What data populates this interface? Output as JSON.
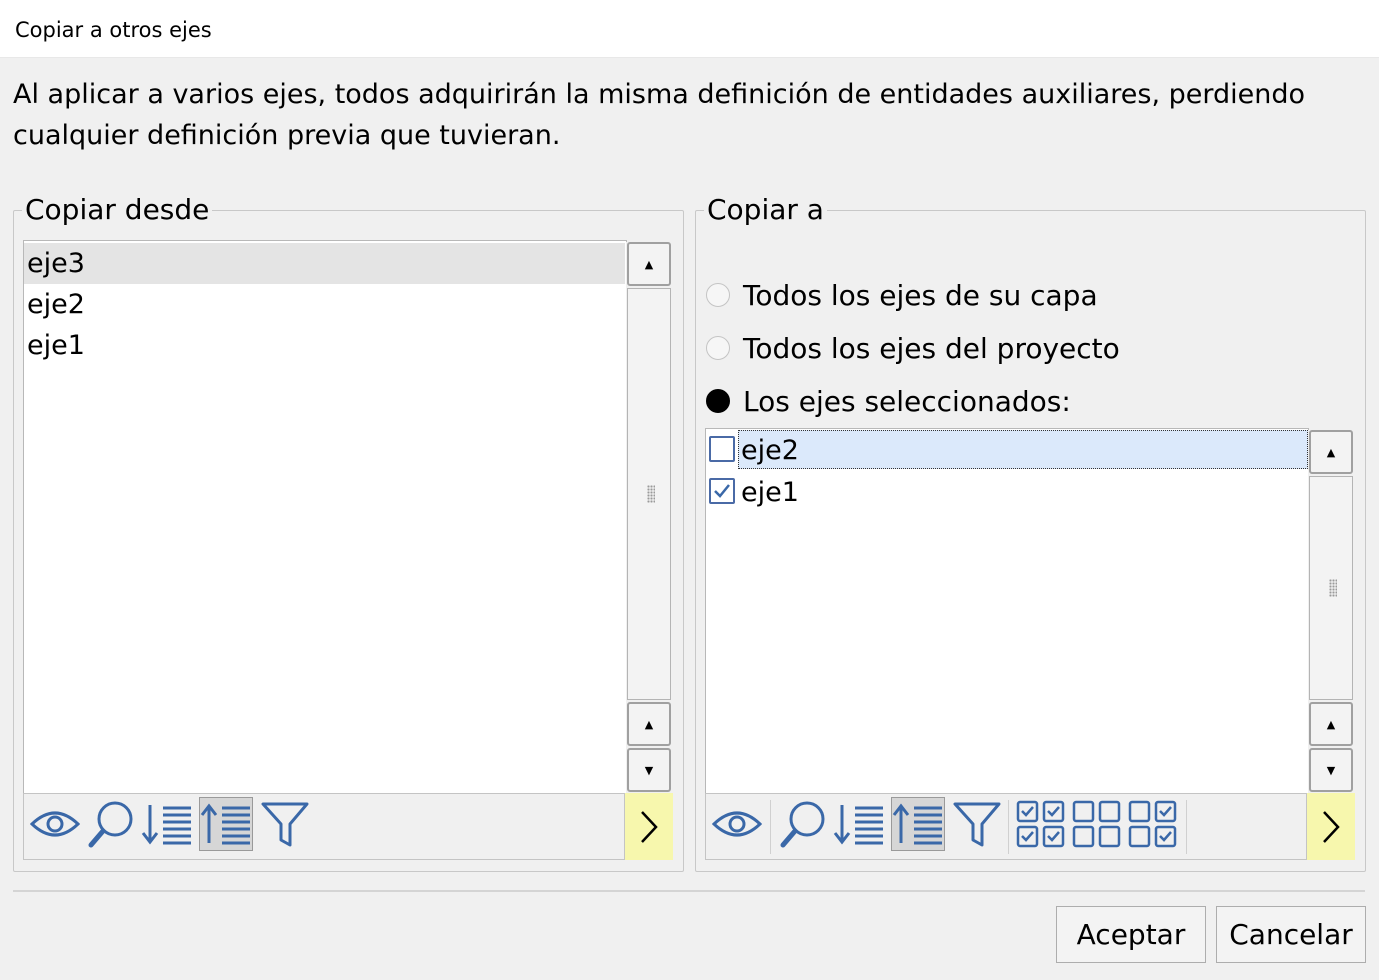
{
  "window": {
    "title": "Copiar a otros ejes"
  },
  "intro_text": "Al aplicar a varios ejes, todos adquirirán la misma definición de entidades auxiliares, perdiendo cualquier definición previa que tuvieran.",
  "source_group": {
    "legend": "Copiar desde",
    "items": [
      {
        "label": "eje3",
        "selected": true
      },
      {
        "label": "eje2",
        "selected": false
      },
      {
        "label": "eje1",
        "selected": false
      }
    ]
  },
  "target_group": {
    "legend": "Copiar a",
    "options": [
      {
        "label": "Todos los ejes de su capa",
        "checked": false
      },
      {
        "label": "Todos los ejes del proyecto",
        "checked": false
      },
      {
        "label": "Los ejes seleccionados:",
        "checked": true
      }
    ],
    "items": [
      {
        "label": "eje2",
        "checked": false,
        "focused": true
      },
      {
        "label": "eje1",
        "checked": true,
        "focused": false
      }
    ]
  },
  "toolbar_icons": {
    "view": "eye-icon",
    "search": "magnifier-icon",
    "sort_desc": "sort-descending-icon",
    "sort_asc": "sort-ascending-icon",
    "filter": "funnel-icon",
    "check_all": "check-all-icon",
    "uncheck_all": "uncheck-all-icon",
    "invert": "invert-selection-icon",
    "expand": "chevron-right-icon"
  },
  "buttons": {
    "accept": "Aceptar",
    "cancel": "Cancelar"
  },
  "colors": {
    "icon": "#3a68a8",
    "expander": "#f7f7ad",
    "focus_row": "#dbe9fb"
  }
}
